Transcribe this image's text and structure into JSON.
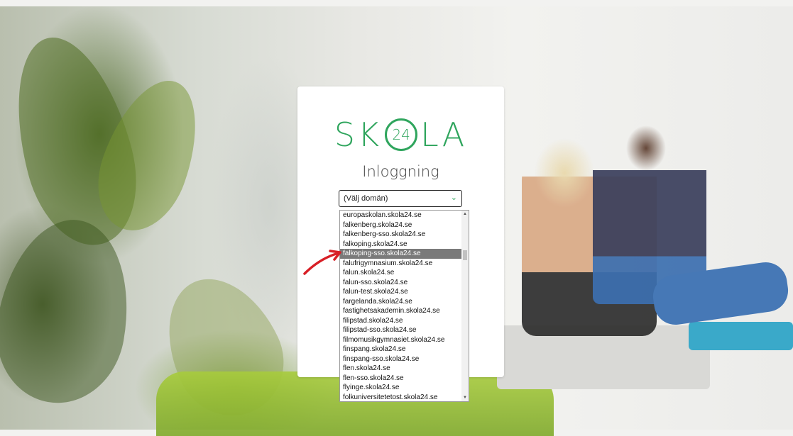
{
  "logo": {
    "left": "SK",
    "number": "24",
    "right": "LA",
    "color": "#2fa55d"
  },
  "login": {
    "title": "Inloggning",
    "domain_select_value": "(Välj domän)"
  },
  "dropdown": {
    "options": [
      "europaskolan.skola24.se",
      "falkenberg.skola24.se",
      "falkenberg-sso.skola24.se",
      "falkoping.skola24.se",
      "falkoping-sso.skola24.se",
      "falufrigymnasium.skola24.se",
      "falun.skola24.se",
      "falun-sso.skola24.se",
      "falun-test.skola24.se",
      "fargelanda.skola24.se",
      "fastighetsakademin.skola24.se",
      "filipstad.skola24.se",
      "filipstad-sso.skola24.se",
      "filmomusikgymnasiet.skola24.se",
      "finspang.skola24.se",
      "finspang-sso.skola24.se",
      "flen.skola24.se",
      "flen-sso.skola24.se",
      "flyinge.skola24.se",
      "folkuniversitetetost.skola24.se"
    ],
    "highlighted": "falkoping-sso.skola24.se"
  },
  "annotation": {
    "arrow_color": "#d81f26",
    "arrow_icon": "red-arrow-icon"
  }
}
